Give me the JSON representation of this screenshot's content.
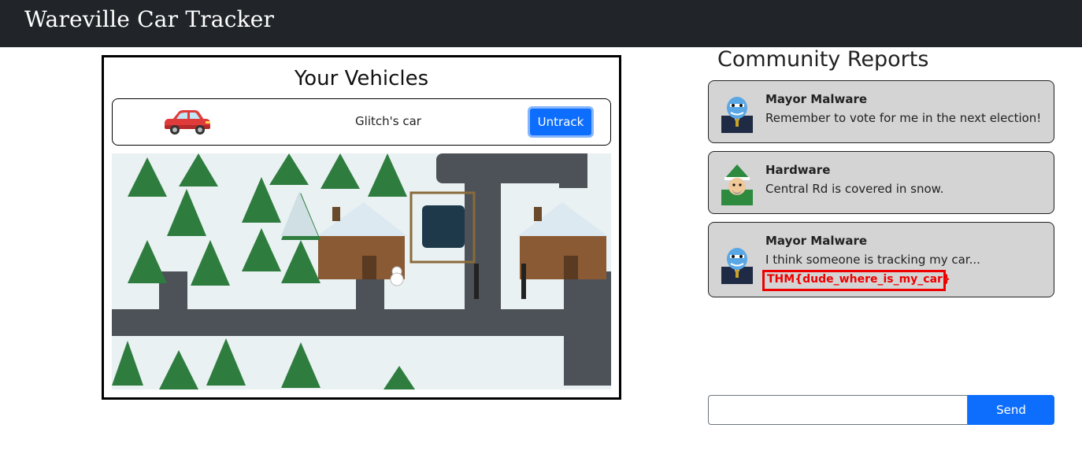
{
  "app": {
    "title": "Wareville Car Tracker"
  },
  "vehicles": {
    "title": "Your Vehicles",
    "items": [
      {
        "name": "Glitch's car",
        "icon": "red-car-icon",
        "action_label": "Untrack"
      }
    ],
    "map_icon": "snowy-town-map"
  },
  "reports": {
    "title": "Community Reports",
    "items": [
      {
        "author": "Mayor Malware",
        "message": "Remember to vote for me in the next election!",
        "avatar": "mayor-malware-avatar"
      },
      {
        "author": "Hardware",
        "message": "Central Rd is covered in snow.",
        "avatar": "elf-avatar"
      },
      {
        "author": "Mayor Malware",
        "message": "I think someone is tracking my car...",
        "flag": "THM{dude_where_is_my_car}",
        "avatar": "mayor-malware-avatar"
      }
    ]
  },
  "composer": {
    "input_value": "",
    "send_label": "Send"
  },
  "colors": {
    "navbar": "#212529",
    "primary": "#0d6efd",
    "report_bg": "#d4d4d4",
    "flag_red": "#e00000"
  }
}
